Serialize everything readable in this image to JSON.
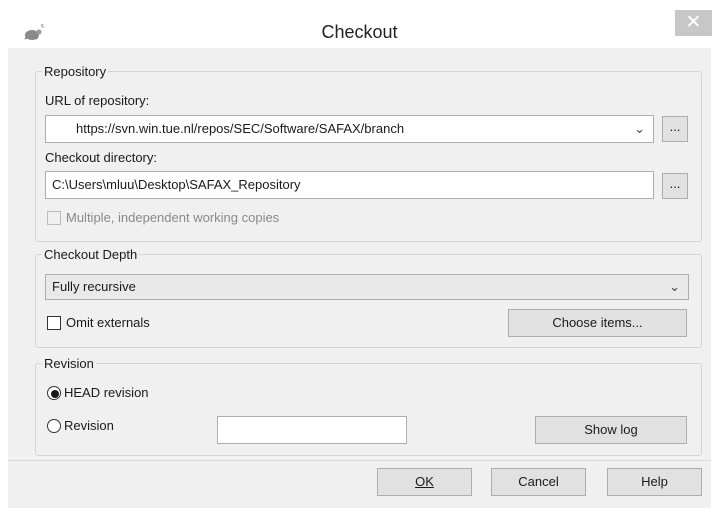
{
  "window": {
    "title": "Checkout",
    "close_glyph": "✕"
  },
  "repository": {
    "legend": "Repository",
    "url_label": "URL of repository:",
    "url_value": "https://svn.win.tue.nl/repos/SEC/Software/SAFAX/branch",
    "browse_url_label": "...",
    "dir_label": "Checkout directory:",
    "dir_value": "C:\\Users\\mluu\\Desktop\\SAFAX_Repository",
    "browse_dir_label": "...",
    "multiple_copies_label": "Multiple, independent working copies",
    "multiple_copies_checked": false
  },
  "depth": {
    "legend": "Checkout Depth",
    "selected": "Fully recursive",
    "omit_externals_label": "Omit externals",
    "omit_externals_checked": false,
    "choose_items_label": "Choose items..."
  },
  "revision": {
    "legend": "Revision",
    "head_label": "HEAD revision",
    "head_selected": true,
    "revision_label": "Revision",
    "revision_value": "",
    "show_log_label": "Show log"
  },
  "buttons": {
    "ok": "OK",
    "cancel": "Cancel",
    "help": "Help"
  },
  "icons": {
    "app": "tortoise-icon",
    "dropdown": "chevron-down-icon",
    "close": "close-icon"
  },
  "colors": {
    "dialog_bg": "#f0f0f0",
    "button_bg": "#e1e1e1",
    "close_bg": "#c7c7c7"
  }
}
